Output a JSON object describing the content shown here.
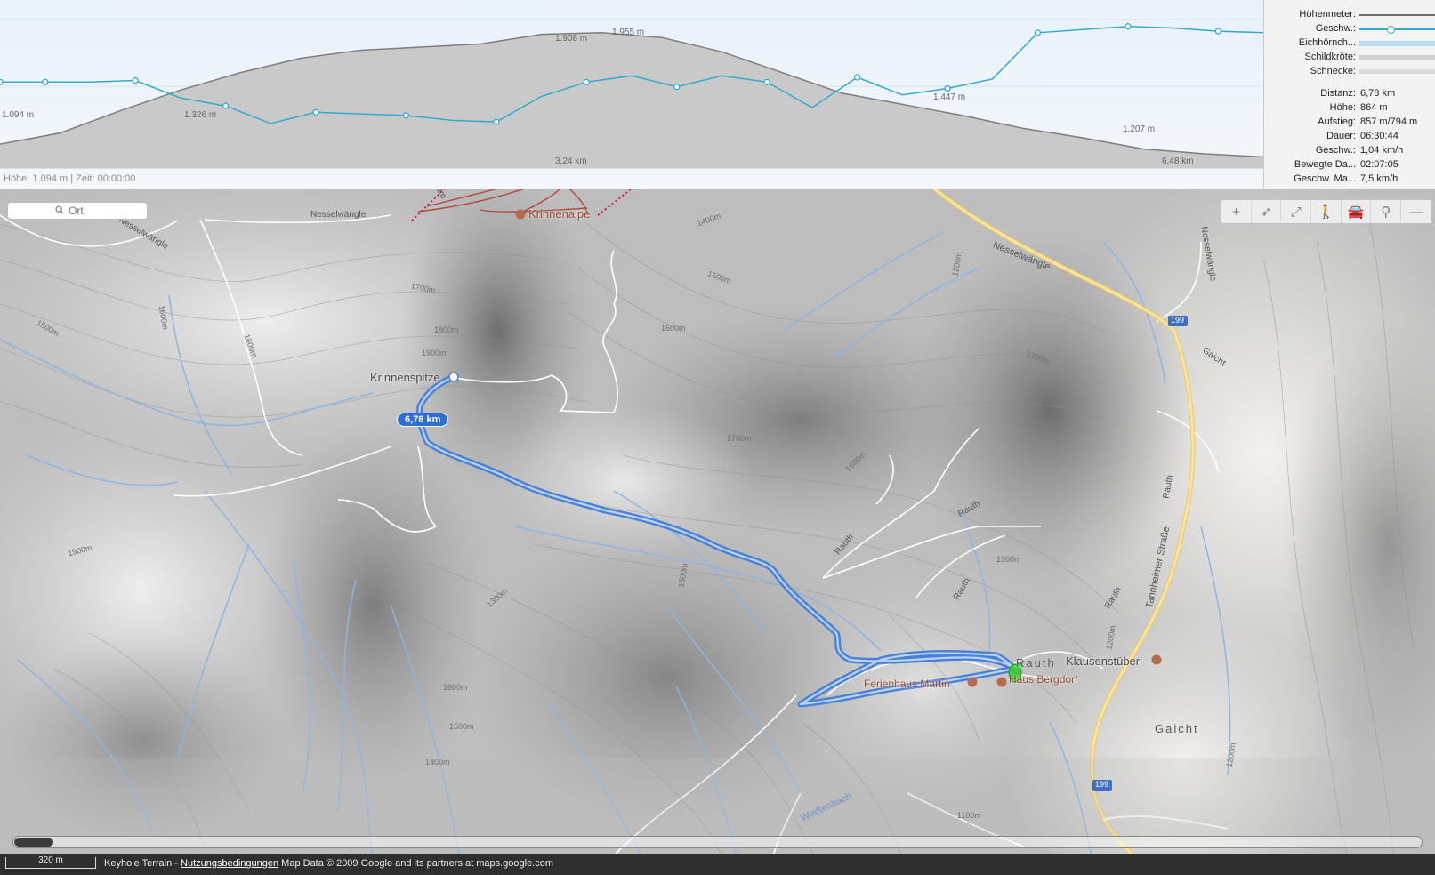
{
  "profile": {
    "status": "Höhe: 1.094 m | Zeit: 00:00:00",
    "altitude_labels": [
      "1.094 m",
      "1.326 m",
      "1.908 m",
      "1.955 m",
      "1.447 m",
      "1.207 m"
    ],
    "distance_labels": [
      "3,24 km",
      "6,48 km"
    ],
    "elevation_series": [
      0.15,
      0.22,
      0.36,
      0.49,
      0.6,
      0.69,
      0.74,
      0.76,
      0.78,
      0.84,
      0.85,
      0.82,
      0.73,
      0.6,
      0.47,
      0.4,
      0.33,
      0.25,
      0.19,
      0.12,
      0.09,
      0.07
    ],
    "speed_series": [
      0.54,
      0.54,
      0.54,
      0.55,
      0.44,
      0.39,
      0.28,
      0.35,
      0.34,
      0.33,
      0.3,
      0.29,
      0.45,
      0.54,
      0.58,
      0.51,
      0.58,
      0.54,
      0.38,
      0.57,
      0.46,
      0.5,
      0.56,
      0.85,
      0.87,
      0.89,
      0.88,
      0.86,
      0.85
    ],
    "colors": {
      "elevation_fill": "#c9c9c9",
      "elevation_line": "#7d7d7d",
      "speed_line": "#33aacc"
    }
  },
  "legend": [
    {
      "label": "Höhenmeter:",
      "color": "#6b6b6b"
    },
    {
      "label": "Geschw.:",
      "color": "#33aacc"
    },
    {
      "label": "Eichhörnch...",
      "color": "#b5dcef"
    },
    {
      "label": "Schildkröte:",
      "color": "#d0d0d0"
    },
    {
      "label": "Schnecke:",
      "color": "#dcdcdc"
    }
  ],
  "stats": [
    {
      "label": "Distanz:",
      "value": "6,78 km"
    },
    {
      "label": "Höhe:",
      "value": "864 m"
    },
    {
      "label": "Aufstieg:",
      "value": "857 m/794 m"
    },
    {
      "label": "Dauer:",
      "value": "06:30:44"
    },
    {
      "label": "Geschw.:",
      "value": "1,04 km/h"
    },
    {
      "label": "Bewegte Da...",
      "value": "02:07:05"
    },
    {
      "label": "Geschw. Ma...",
      "value": "7,5 km/h"
    }
  ],
  "search": {
    "placeholder": "Ort"
  },
  "toolbar": [
    {
      "name": "zoom-in",
      "glyph": "+"
    },
    {
      "name": "locate",
      "glyph": "➶"
    },
    {
      "name": "fit-track",
      "glyph": "⤢"
    },
    {
      "name": "walk-mode",
      "glyph": "🚶"
    },
    {
      "name": "car-mode",
      "glyph": "🚘"
    },
    {
      "name": "pin-mode",
      "glyph": "⚲"
    },
    {
      "name": "collapse",
      "glyph": "—"
    }
  ],
  "map": {
    "track_label": "6,78 km",
    "places": [
      {
        "id": "krinnenspitze",
        "text": "Krinnenspitze"
      },
      {
        "id": "krinnenalpe",
        "text": "Krinnenalpe"
      },
      {
        "id": "ferienhaus-martin",
        "text": "Ferienhaus Martin"
      },
      {
        "id": "haus-bergdorf",
        "text": "Haus Bergdorf"
      },
      {
        "id": "klausenstueberl",
        "text": "Klausenstüberl"
      },
      {
        "id": "gaicht-town",
        "text": "Gaicht"
      },
      {
        "id": "rauth-town",
        "text": "Rauth"
      }
    ],
    "roads": {
      "nesselwaengle_1": "Nesselwängle",
      "nesselwaengle_2": "Nesselwängle",
      "nesselwaengle_3": "Nesselwängle",
      "nesselwaengle_4": "Nesselwängle",
      "tannheimer": "Tannheimer Straße",
      "gaicht_road": "Gaicht",
      "route_199_a": "199",
      "route_199_b": "199",
      "rauth_1": "Rauth",
      "rauth_2": "Rauth",
      "rauth_3": "Rauth",
      "rauth_4": "Rauth",
      "rauth_5": "Rauth",
      "weissenbach": "Weißenbach",
      "alm": "Alm"
    },
    "contours": {
      "c1700a": "1700m",
      "c1800a": "1800m",
      "c1900a": "1900m",
      "c1400a": "1400m",
      "c1500a": "1500m",
      "c1600a": "1600m",
      "c1300a": "1300m",
      "c1700b": "1700m",
      "c1600b": "1600m",
      "c1800b": "1800m",
      "c1500b": "1500m",
      "c1900b": "1900m",
      "c1500c": "1500m",
      "c1600c": "1600m",
      "c1200a": "1200m",
      "c1300b": "1300m",
      "c1400b": "1400m",
      "c1600d": "1600m",
      "c1500d": "1500m",
      "c1100a": "1100m",
      "c1200b": "1200m",
      "c1300c": "1300m",
      "c1200c": "1200m"
    }
  },
  "footer": {
    "scale": "320 m",
    "attribution_prefix": "Keyhole Terrain - ",
    "terms_link": "Nutzungsbedingungen",
    "attribution_suffix": " Map Data © 2009 Google and its partners at maps.google.com"
  }
}
